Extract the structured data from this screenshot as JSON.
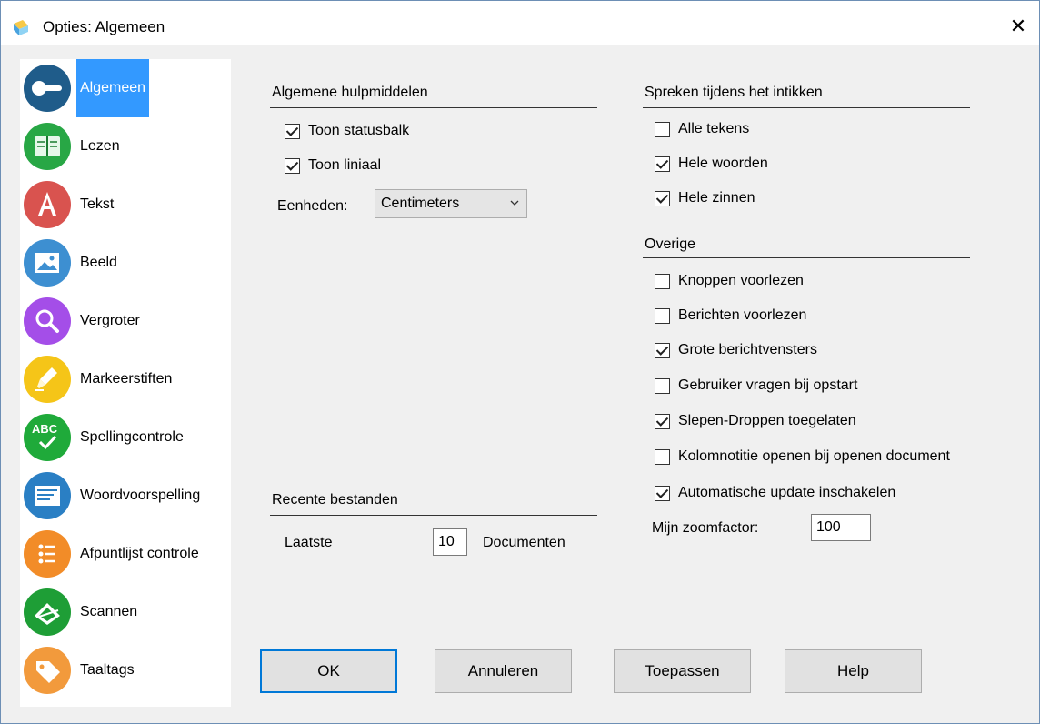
{
  "window": {
    "title": "Opties: Algemeen",
    "close_glyph": "✕"
  },
  "sidebar": {
    "items": [
      {
        "label": "Algemeen",
        "icon": "key-icon",
        "color": "#1f5c8a",
        "active": true
      },
      {
        "label": "Lezen",
        "icon": "book-icon",
        "color": "#28a745"
      },
      {
        "label": "Tekst",
        "icon": "letter-a-icon",
        "color": "#d9534f"
      },
      {
        "label": "Beeld",
        "icon": "image-icon",
        "color": "#3d8fd1"
      },
      {
        "label": "Vergroter",
        "icon": "magnifier-icon",
        "color": "#a44ee8"
      },
      {
        "label": "Markeerstiften",
        "icon": "marker-icon",
        "color": "#f5c518"
      },
      {
        "label": "Spellingcontrole",
        "icon": "abc-check-icon",
        "color": "#1faa3a"
      },
      {
        "label": "Woordvoorspelling",
        "icon": "prediction-icon",
        "color": "#2a7fc4"
      },
      {
        "label": "Afpuntlijst controle",
        "icon": "checklist-icon",
        "color": "#f28c28"
      },
      {
        "label": "Scannen",
        "icon": "scanner-icon",
        "color": "#1e9e36"
      },
      {
        "label": "Taaltags",
        "icon": "tag-icon",
        "color": "#f29a3c"
      }
    ]
  },
  "general": {
    "title": "Algemene hulpmiddelen",
    "show_statusbar": {
      "label": "Toon statusbalk",
      "checked": true
    },
    "show_ruler": {
      "label": "Toon liniaal",
      "checked": true
    },
    "units_label": "Eenheden:",
    "units_value": "Centimeters"
  },
  "recent": {
    "title": "Recente bestanden",
    "prefix": "Laatste",
    "count": "10",
    "suffix": "Documenten"
  },
  "speak": {
    "title": "Spreken tijdens het intikken",
    "items": [
      {
        "label": "Alle tekens",
        "checked": false
      },
      {
        "label": "Hele woorden",
        "checked": true
      },
      {
        "label": "Hele zinnen",
        "checked": true
      }
    ]
  },
  "other": {
    "title": "Overige",
    "items": [
      {
        "label": "Knoppen voorlezen",
        "checked": false
      },
      {
        "label": "Berichten voorlezen",
        "checked": false
      },
      {
        "label": "Grote berichtvensters",
        "checked": true
      },
      {
        "label": "Gebruiker vragen bij opstart",
        "checked": false
      },
      {
        "label": "Slepen-Droppen toegelaten",
        "checked": true
      },
      {
        "label": "Kolomnotitie openen bij openen document",
        "checked": false
      },
      {
        "label": "Automatische update inschakelen",
        "checked": true
      }
    ],
    "zoom_label": "Mijn zoomfactor:",
    "zoom_value": "100"
  },
  "buttons": {
    "ok": "OK",
    "cancel": "Annuleren",
    "apply": "Toepassen",
    "help": "Help"
  }
}
